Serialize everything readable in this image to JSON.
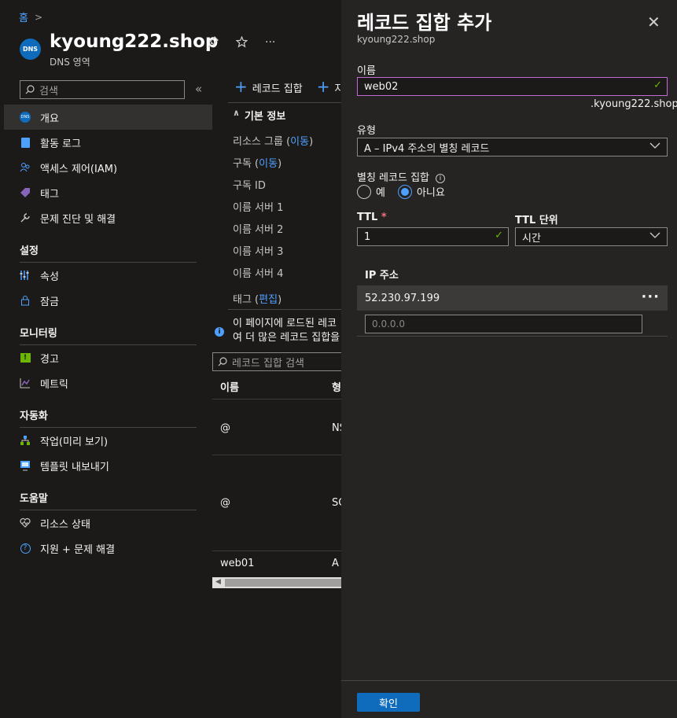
{
  "breadcrumb": {
    "home": "홈",
    "sep": ">"
  },
  "resource": {
    "icon_text": "DNS",
    "title": "kyoung222.shop",
    "subtitle": "DNS 영역",
    "actions": [
      "pin-icon",
      "star-icon",
      "more-icon"
    ]
  },
  "nav": {
    "search_placeholder": "검색",
    "collapse": "«",
    "items": [
      {
        "label": "개요",
        "icon": "dns-icon",
        "active": true
      },
      {
        "label": "활동 로그",
        "icon": "log-icon"
      },
      {
        "label": "액세스 제어(IAM)",
        "icon": "people-icon"
      },
      {
        "label": "태그",
        "icon": "tag-icon"
      },
      {
        "label": "문제 진단 및 해결",
        "icon": "wrench-icon"
      }
    ],
    "sections": [
      {
        "title": "설정",
        "items": [
          {
            "label": "속성",
            "icon": "properties-icon"
          },
          {
            "label": "잠금",
            "icon": "lock-icon"
          }
        ]
      },
      {
        "title": "모니터링",
        "items": [
          {
            "label": "경고",
            "icon": "alert-icon"
          },
          {
            "label": "메트릭",
            "icon": "metrics-icon"
          }
        ]
      },
      {
        "title": "자동화",
        "items": [
          {
            "label": "작업(미리 보기)",
            "icon": "tasks-icon"
          },
          {
            "label": "템플릿 내보내기",
            "icon": "template-icon"
          }
        ]
      },
      {
        "title": "도움말",
        "items": [
          {
            "label": "리소스 상태",
            "icon": "heart-icon"
          },
          {
            "label": "지원 + 문제 해결",
            "icon": "help-icon"
          }
        ]
      }
    ]
  },
  "content": {
    "commands": {
      "add_recordset": "레코드 집합",
      "add_child": "자"
    },
    "essentials_title": "기본 정보",
    "essentials": {
      "resource_group": "리소스 그룹",
      "resource_group_link": "이동",
      "subscription": "구독",
      "subscription_link": "이동",
      "subscription_id": "구독 ID",
      "ns1": "이름 서버 1",
      "ns2": "이름 서버 2",
      "ns3": "이름 서버 3",
      "ns4": "이름 서버 4",
      "tags": "태그",
      "tags_link": "편집"
    },
    "info_banner_line1": "이 페이지에 로드된 레코",
    "info_banner_line2": "여 더 많은 레코드 집합을",
    "recordset_search_placeholder": "레코드 집합 검색",
    "table": {
      "col_name": "이름",
      "col_type": "형",
      "rows": [
        {
          "name": "@",
          "type": "NS"
        },
        {
          "name": "@",
          "type": "SO"
        },
        {
          "name": "web01",
          "type": "A"
        }
      ]
    }
  },
  "panel": {
    "title": "레코드 집합 추가",
    "subtitle": "kyoung222.shop",
    "close": "✕",
    "name_label": "이름",
    "name_value": "web02",
    "name_suffix": ".kyoung222.shop",
    "type_label": "유형",
    "type_value": "A – IPv4 주소의 별칭 레코드",
    "alias_label": "별칭 레코드 집합",
    "alias_options": {
      "yes": "예",
      "no": "아니요",
      "selected": "no"
    },
    "ttl_label": "TTL",
    "ttl_required": "*",
    "ttl_value": "1",
    "ttl_unit_label": "TTL 단위",
    "ttl_unit_value": "시간",
    "ip_header": "IP 주소",
    "ip_values": [
      "52.230.97.199"
    ],
    "ip_placeholder": "0.0.0.0",
    "ok_label": "확인"
  },
  "colors": {
    "accent": "#4ea0ff",
    "primary_button": "#0f6cbd",
    "focus_border": "#c36bd6",
    "valid": "#6bb700",
    "required": "#f1707b"
  }
}
